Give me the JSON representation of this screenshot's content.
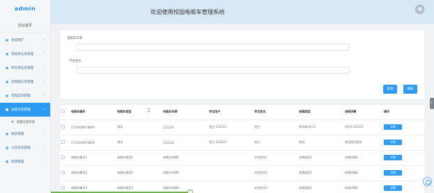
{
  "app": {
    "logo": "admin",
    "title": "欢迎使用校园电瓶车管理系统"
  },
  "sidebar": {
    "home": "后台首页",
    "items": [
      {
        "label": "系统用户"
      },
      {
        "label": "电瓶车信息管理"
      },
      {
        "label": "停车场信息管理"
      },
      {
        "label": "充电桩信息管理"
      },
      {
        "label": "充电信息管理"
      },
      {
        "label": "违规信息管理",
        "active": true
      },
      {
        "label": "系统管理"
      },
      {
        "label": "公告信息管理"
      },
      {
        "label": "资源管理"
      }
    ],
    "sub_item": "违规信息列表"
  },
  "search": {
    "plate_label": "电瓶车车牌",
    "plate_value": "",
    "name_label": "学生姓名",
    "name_value": "",
    "query_button": "查询",
    "delete_button": "删除"
  },
  "table": {
    "columns": [
      "电瓶车编号",
      "电瓶车类型",
      "电瓶车车牌",
      "学生用户",
      "学生姓名",
      "违规类型",
      "违规详情",
      "操作"
    ],
    "detail_label": "详情",
    "rows": [
      [
        "1710319074839",
        "测试",
        "112233",
        "张三 123123",
        "张三",
        "测试测试111",
        "测试1112222"
      ],
      [
        "1710319074839",
        "测试",
        "112233",
        "张三 123123",
        "张三",
        "测试",
        "测试测试测试"
      ],
      [
        "电瓶车编号1",
        "电瓶车类型1",
        "电瓶车车牌1",
        "",
        "学生姓名1",
        "违规类型1",
        "违规详情1"
      ],
      [
        "电瓶车编号2",
        "电瓶车类型2",
        "电瓶车车牌2",
        "",
        "学生姓名2",
        "违规类型2",
        "违规详情2"
      ],
      [
        "电瓶车编号3",
        "电瓶车类型3",
        "电瓶车车牌3",
        "",
        "学生姓名3",
        "违规类型3",
        "违规详情3"
      ]
    ]
  },
  "colors": {
    "accent": "#2f9bf2",
    "header_bg": "#d9e8f7",
    "sidebar_bg": "#f4f6f8"
  },
  "icons": {
    "nav_bullet": "dot-icon",
    "chevron": "chevron-left-icon",
    "sub_item": "gear-icon",
    "avatar": "user-avatar-icon"
  }
}
